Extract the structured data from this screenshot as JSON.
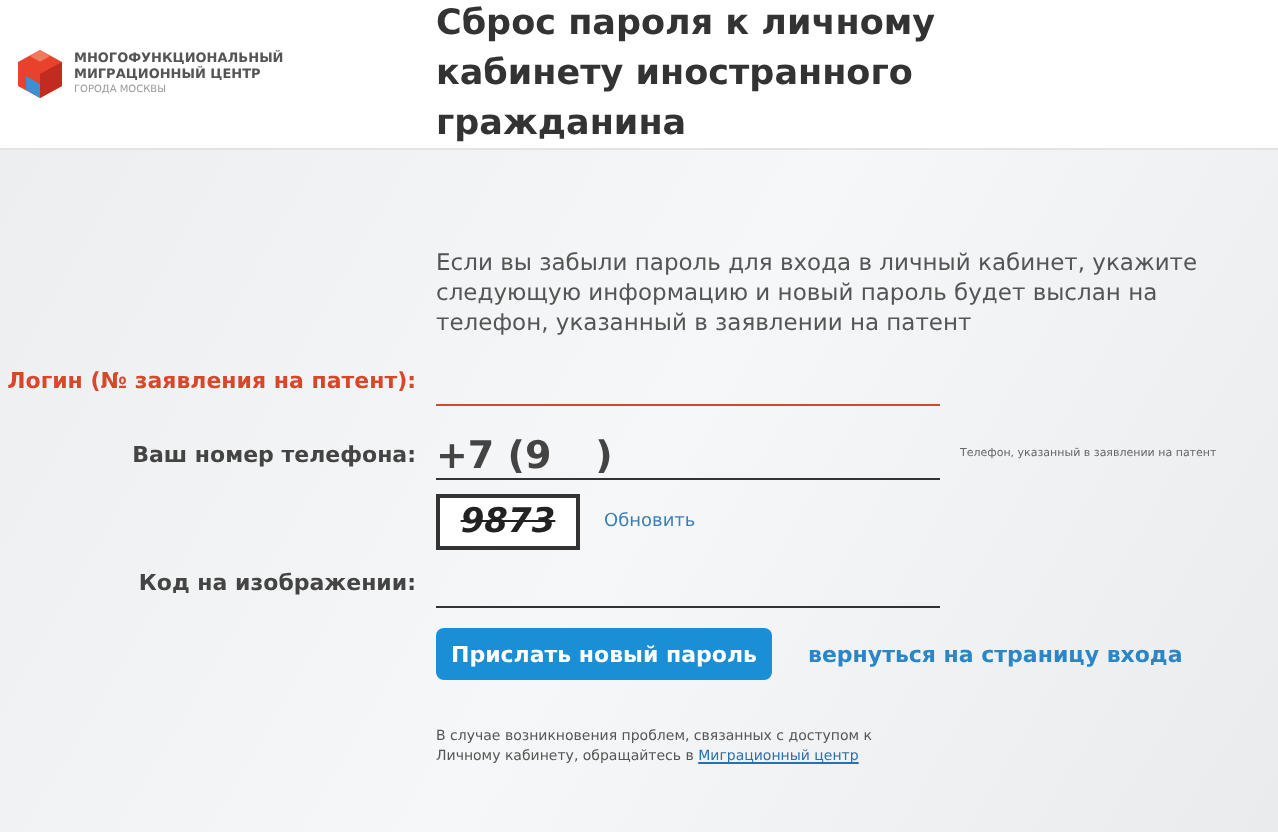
{
  "logo": {
    "line_1": "МНОГОФУНКЦИОНАЛЬНЫЙ",
    "line_2": "МИГРАЦИОННЫЙ ЦЕНТР",
    "line_3": "ГОРОДА МОСКВЫ"
  },
  "title": "Сброс пароля к личному кабинету иностранного гражданина",
  "intro": "Если вы забыли пароль для входа в личный кабинет, укажите следующую информацию и новый пароль будет выслан на телефон, указанный в заявлении на патент",
  "login": {
    "label": "Логин (№ заявления на патент):",
    "error": true
  },
  "phone": {
    "label": "Ваш номер телефона:",
    "prefix": "+7 (9",
    "suffix": ")",
    "hint": "Телефон, указанный в заявлении на патент"
  },
  "captcha": {
    "text": "9873",
    "refresh": "Обновить"
  },
  "code": {
    "label": "Код на изображении:"
  },
  "submit": "Прислать новый пароль",
  "back_link": "вернуться на страницу входа",
  "footer": {
    "text": "В случае возникновения проблем, связанных с доступом к Личному кабинету, обращайтесь в",
    "link": "Миграционный центр"
  }
}
